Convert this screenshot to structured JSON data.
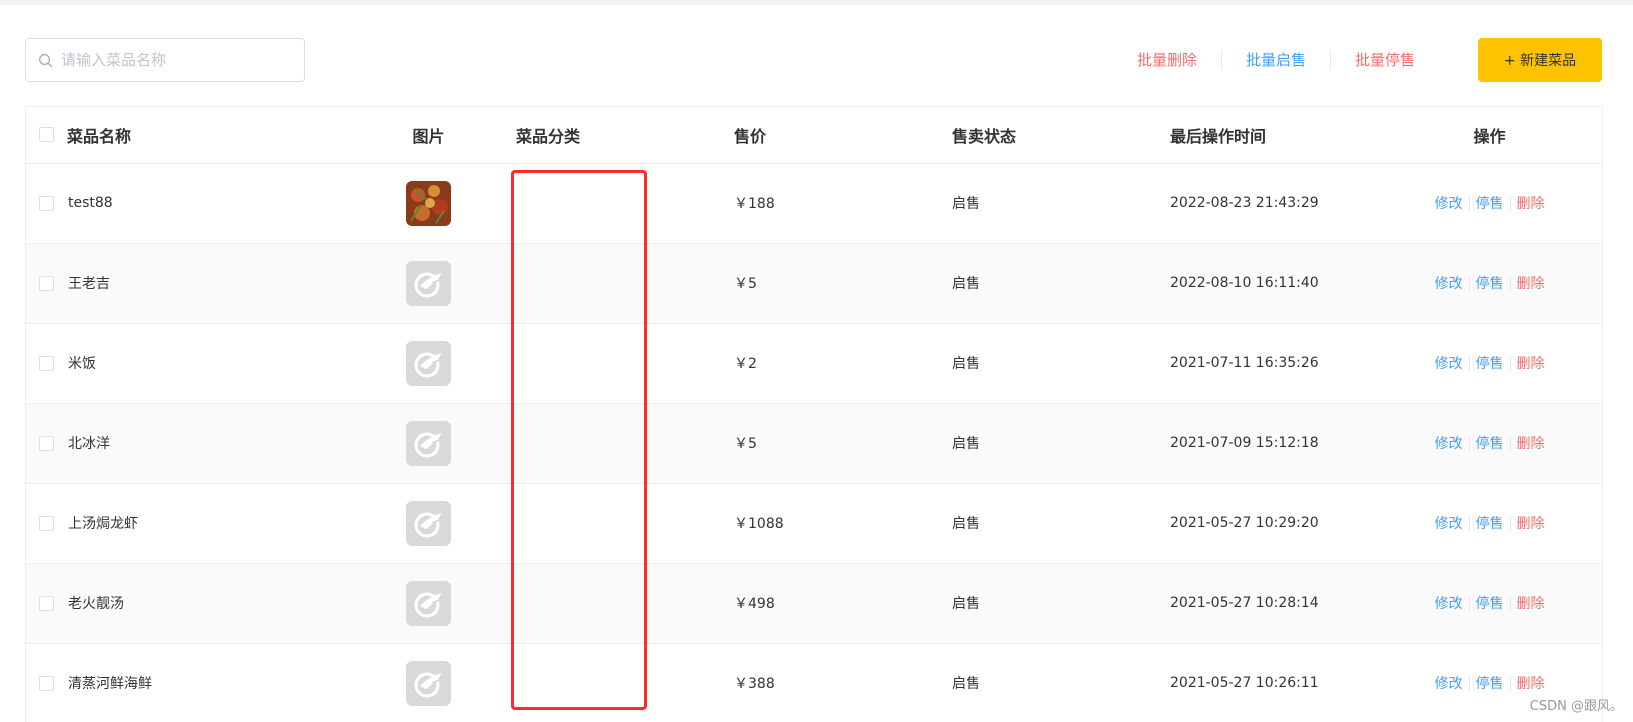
{
  "search": {
    "placeholder": "请输入菜品名称",
    "value": ""
  },
  "toolbar": {
    "batch_delete": "批量删除",
    "batch_enable": "批量启售",
    "batch_disable": "批量停售",
    "new_dish": "+ 新建菜品"
  },
  "table": {
    "headers": {
      "name": "菜品名称",
      "image": "图片",
      "category": "菜品分类",
      "price": "售价",
      "status": "售卖状态",
      "time": "最后操作时间",
      "ops": "操作"
    },
    "rows": [
      {
        "name": "test88",
        "image": "dish-photo",
        "category": "",
        "price": "￥188",
        "status": "启售",
        "time": "2022-08-23 21:43:29"
      },
      {
        "name": "王老吉",
        "image": "placeholder-logo",
        "category": "",
        "price": "￥5",
        "status": "启售",
        "time": "2022-08-10 16:11:40"
      },
      {
        "name": "米饭",
        "image": "placeholder-logo",
        "category": "",
        "price": "￥2",
        "status": "启售",
        "time": "2021-07-11 16:35:26"
      },
      {
        "name": "北冰洋",
        "image": "placeholder-logo",
        "category": "",
        "price": "￥5",
        "status": "启售",
        "time": "2021-07-09 15:12:18"
      },
      {
        "name": "上汤焗龙虾",
        "image": "placeholder-logo",
        "category": "",
        "price": "￥1088",
        "status": "启售",
        "time": "2021-05-27 10:29:20"
      },
      {
        "name": "老火靓汤",
        "image": "placeholder-logo",
        "category": "",
        "price": "￥498",
        "status": "启售",
        "time": "2021-05-27 10:28:14"
      },
      {
        "name": "清蒸河鲜海鲜",
        "image": "placeholder-logo",
        "category": "",
        "price": "￥388",
        "status": "启售",
        "time": "2021-05-27 10:26:11"
      }
    ],
    "row_actions": {
      "edit": "修改",
      "disable": "停售",
      "delete": "删除"
    }
  },
  "watermark": "CSDN @跟风。",
  "colors": {
    "accent": "#ffc200",
    "link_blue": "#419eff",
    "link_red": "#f56c6c",
    "highlight": "#ff2b2b"
  }
}
